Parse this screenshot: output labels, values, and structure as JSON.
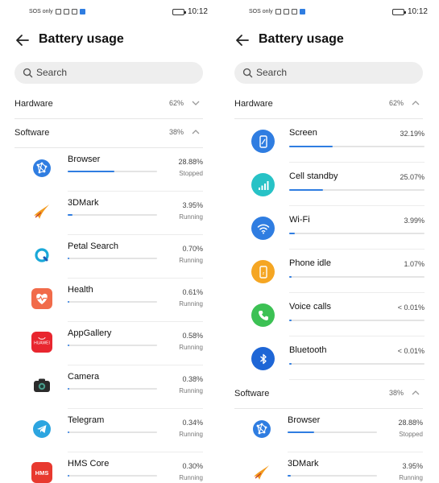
{
  "left": {
    "status": {
      "sos": "SOS only",
      "time": "10:12"
    },
    "title": "Battery usage",
    "search_placeholder": "Search",
    "hardware": {
      "label": "Hardware",
      "percent": "62%"
    },
    "software": {
      "label": "Software",
      "percent": "38%"
    },
    "apps": [
      {
        "name": "Browser",
        "value": "28.88%",
        "state": "Stopped",
        "fill": 0.52,
        "icon": "browser-icon",
        "color": "#2f7de1"
      },
      {
        "name": "3DMark",
        "value": "3.95%",
        "state": "Running",
        "fill": 0.05,
        "icon": "3dmark-icon",
        "color": "#f39a1e"
      },
      {
        "name": "Petal Search",
        "value": "0.70%",
        "state": "Running",
        "fill": 0.01,
        "icon": "petal-search-icon",
        "color": "#1aa8d8"
      },
      {
        "name": "Health",
        "value": "0.61%",
        "state": "Running",
        "fill": 0.01,
        "icon": "health-icon",
        "color": "#f16b4a"
      },
      {
        "name": "AppGallery",
        "value": "0.58%",
        "state": "Running",
        "fill": 0.01,
        "icon": "appgallery-icon",
        "color": "#e8262f",
        "icon_text": "HUAWEI"
      },
      {
        "name": "Camera",
        "value": "0.38%",
        "state": "Running",
        "fill": 0.005,
        "icon": "camera-icon",
        "color": "#2b2b2b"
      },
      {
        "name": "Telegram",
        "value": "0.34%",
        "state": "Running",
        "fill": 0.005,
        "icon": "telegram-icon",
        "color": "#2ca5e0"
      },
      {
        "name": "HMS Core",
        "value": "0.30%",
        "state": "Running",
        "fill": 0.005,
        "icon": "hms-core-icon",
        "color": "#e8392f",
        "icon_text": "HMS"
      }
    ]
  },
  "right": {
    "status": {
      "sos": "SOS only",
      "time": "10:12"
    },
    "title": "Battery usage",
    "search_placeholder": "Search",
    "hardware": {
      "label": "Hardware",
      "percent": "62%"
    },
    "software": {
      "label": "Software",
      "percent": "38%"
    },
    "hardware_items": [
      {
        "name": "Screen",
        "value": "32.19%",
        "fill": 0.32,
        "icon": "screen-icon",
        "color": "#2f7de1"
      },
      {
        "name": "Cell standby",
        "value": "25.07%",
        "fill": 0.25,
        "icon": "cell-standby-icon",
        "color": "#27c2c6"
      },
      {
        "name": "Wi-Fi",
        "value": "3.99%",
        "fill": 0.04,
        "icon": "wifi-icon",
        "color": "#2f7de1"
      },
      {
        "name": "Phone idle",
        "value": "1.07%",
        "fill": 0.01,
        "icon": "phone-idle-icon",
        "color": "#f5a623"
      },
      {
        "name": "Voice calls",
        "value": "< 0.01%",
        "fill": 0.0,
        "icon": "voice-calls-icon",
        "color": "#3cc154"
      },
      {
        "name": "Bluetooth",
        "value": "< 0.01%",
        "fill": 0.0,
        "icon": "bluetooth-icon",
        "color": "#1e66d6"
      }
    ],
    "apps": [
      {
        "name": "Browser",
        "value": "28.88%",
        "state": "Stopped",
        "fill": 0.3,
        "icon": "browser-icon",
        "color": "#2f7de1"
      },
      {
        "name": "3DMark",
        "value": "3.95%",
        "state": "Running",
        "fill": 0.04,
        "icon": "3dmark-icon",
        "color": "#f39a1e"
      }
    ]
  }
}
